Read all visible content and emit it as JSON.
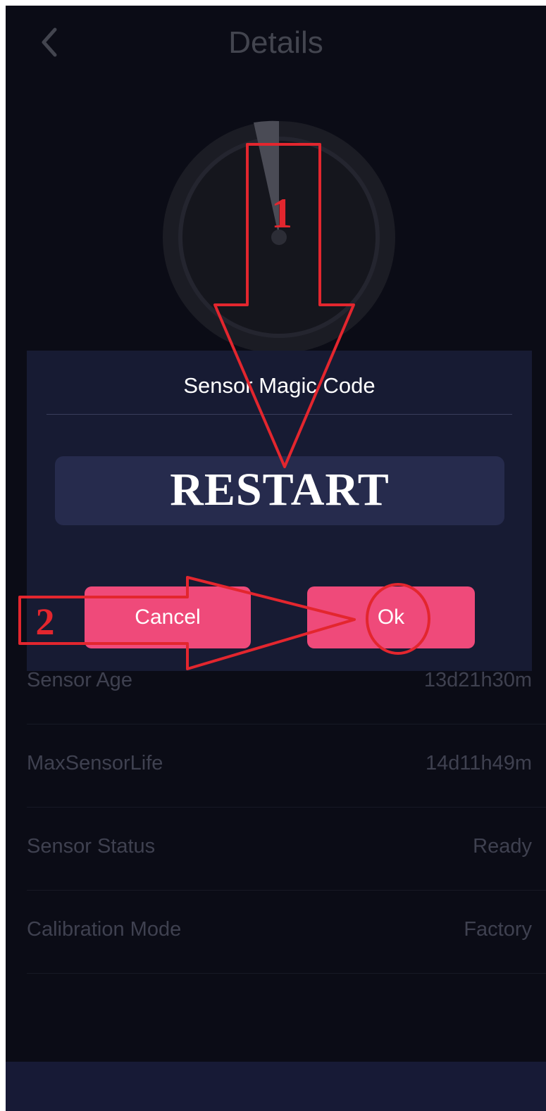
{
  "header": {
    "title": "Details"
  },
  "dialog": {
    "title": "Sensor Magic Code",
    "code_value": "RESTART",
    "cancel_label": "Cancel",
    "ok_label": "Ok"
  },
  "details": {
    "rows": [
      {
        "label": "Sensor Age",
        "value": "13d21h30m"
      },
      {
        "label": "MaxSensorLife",
        "value": "14d11h49m"
      },
      {
        "label": "Sensor Status",
        "value": "Ready"
      },
      {
        "label": "Calibration Mode",
        "value": "Factory"
      }
    ]
  },
  "annotations": {
    "step1": "1",
    "step2": "2"
  },
  "colors": {
    "background": "#0b0c16",
    "dialog": "#171b33",
    "accent": "#ef4a7a",
    "annotation": "#e3262e"
  }
}
